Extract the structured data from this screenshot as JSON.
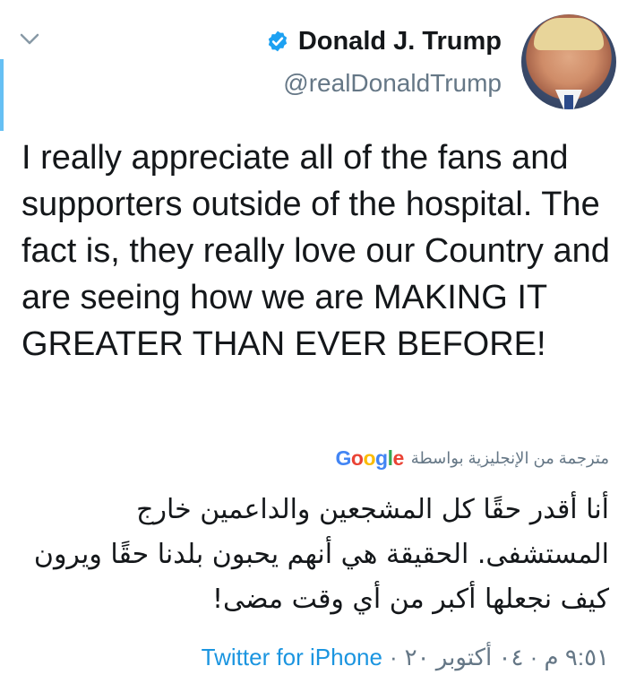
{
  "user": {
    "display_name": "Donald J. Trump",
    "handle": "@realDonaldTrump",
    "verified_icon": "verified-badge-icon"
  },
  "tweet": {
    "text": "I really appreciate all of the fans and supporters outside of the hospital. The fact is, they really love our Country and are seeing how we are MAKING IT GREATER THAN EVER BEFORE!"
  },
  "translation": {
    "label": "مترجمة من الإنجليزية بواسطة",
    "provider": "Google",
    "text": "أنا أقدر حقًا كل المشجعين والداعمين خارج المستشفى. الحقيقة هي أنهم يحبون بلدنا حقًا ويرون كيف نجعلها أكبر من أي وقت مضى!"
  },
  "meta": {
    "timestamp": "٩:٥١ م · ٠٤ أكتوبر ٢٠",
    "separator": "·",
    "source": "Twitter for iPhone"
  },
  "colors": {
    "accent": "#1da1f2",
    "link": "#1b95e0",
    "secondary_text": "#657786"
  }
}
